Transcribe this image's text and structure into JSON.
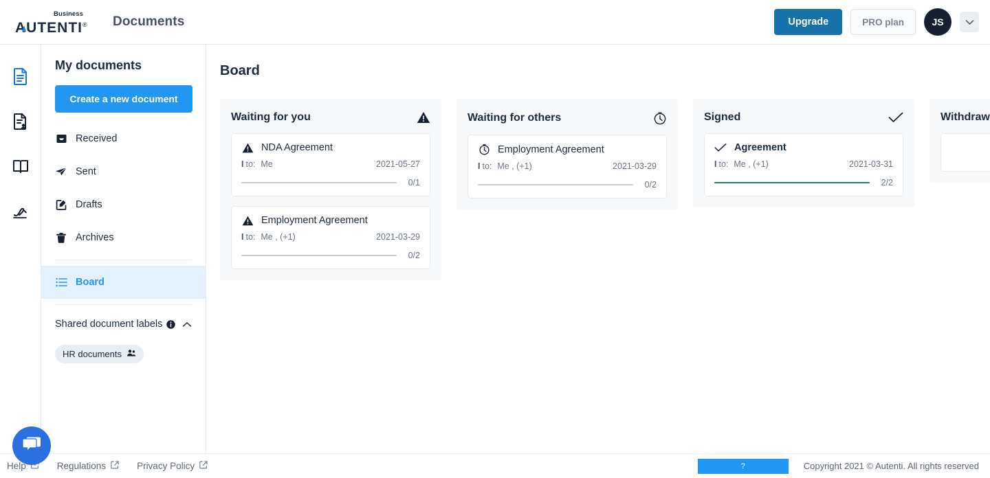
{
  "header": {
    "logo_sup": "Business",
    "logo_main": "AUTENTI",
    "logo_reg": "®",
    "app_title": "Documents",
    "upgrade_label": "Upgrade",
    "plan_label": "PRO plan",
    "avatar_initials": "JS",
    "caret_icon": "chevron-down-icon",
    "accent_color": "#1771ab"
  },
  "rail": {
    "items": [
      {
        "icon": "document-icon",
        "active": true
      },
      {
        "icon": "document-user-icon",
        "active": false
      },
      {
        "icon": "book-icon",
        "active": false
      },
      {
        "icon": "signature-pen-icon",
        "active": false
      }
    ]
  },
  "sidebar": {
    "title": "My documents",
    "create_label": "Create a new document",
    "create_color": "#2196f3",
    "nav": [
      {
        "label": "Received",
        "icon": "inbox-icon",
        "active": false
      },
      {
        "label": "Sent",
        "icon": "paper-plane-icon",
        "active": false
      },
      {
        "label": "Drafts",
        "icon": "edit-square-icon",
        "active": false
      },
      {
        "label": "Archives",
        "icon": "trash-icon",
        "active": false
      }
    ],
    "board_item": {
      "label": "Board",
      "icon": "list-icon",
      "active": true
    },
    "labels_section": {
      "title": "Shared document labels",
      "info_icon": "info-icon",
      "collapse_icon": "chevron-up-icon",
      "chips": [
        {
          "label": "HR documents",
          "icon": "people-icon"
        }
      ]
    },
    "active_bg": "#e4f1fb",
    "active_fg": "#2196f3"
  },
  "main": {
    "page_title": "Board",
    "columns": [
      {
        "title": "Waiting for you",
        "icon": "warning-triangle-icon",
        "cards": [
          {
            "title": "NDA Agreement",
            "title_bold": false,
            "icon": "warning-triangle-icon",
            "meta_prefix": "I",
            "meta_to": "to:",
            "meta_who": "Me",
            "date": "2021-05-27",
            "progress_label": "0/1",
            "progress_value": 0,
            "progress_total": 1
          },
          {
            "title": "Employment Agreement",
            "title_bold": false,
            "icon": "warning-triangle-icon",
            "meta_prefix": "I",
            "meta_to": "to:",
            "meta_who": "Me , (+1)",
            "date": "2021-03-29",
            "progress_label": "0/2",
            "progress_value": 0,
            "progress_total": 2
          }
        ]
      },
      {
        "title": "Waiting for others",
        "icon": "stopwatch-icon",
        "cards": [
          {
            "title": "Employment Agreement",
            "title_bold": false,
            "icon": "stopwatch-icon",
            "meta_prefix": "I",
            "meta_to": "to:",
            "meta_who": "Me , (+1)",
            "date": "2021-03-29",
            "progress_label": "0/2",
            "progress_value": 0,
            "progress_total": 2
          }
        ]
      },
      {
        "title": "Signed",
        "icon": "check-icon",
        "cards": [
          {
            "title": "Agreement",
            "title_bold": true,
            "icon": "check-icon",
            "meta_prefix": "I",
            "meta_to": "to:",
            "meta_who": "Me , (+1)",
            "date": "2021-03-31",
            "progress_label": "2/2",
            "progress_value": 2,
            "progress_total": 2,
            "progress_color": "#1e8458"
          }
        ]
      },
      {
        "title": "Withdrawn",
        "icon": "none",
        "cards": []
      }
    ]
  },
  "footer": {
    "links": [
      {
        "label": "Help",
        "icon": "external-link-icon"
      },
      {
        "label": "Regulations",
        "icon": "external-link-icon"
      },
      {
        "label": "Privacy Policy",
        "icon": "external-link-icon"
      }
    ],
    "help_button_label": "?",
    "copyright": "Copyright 2021 © Autenti. All rights reserved"
  },
  "chat_widget": {
    "icon": "chat-bubbles-icon",
    "color": "#2b6fe0"
  }
}
